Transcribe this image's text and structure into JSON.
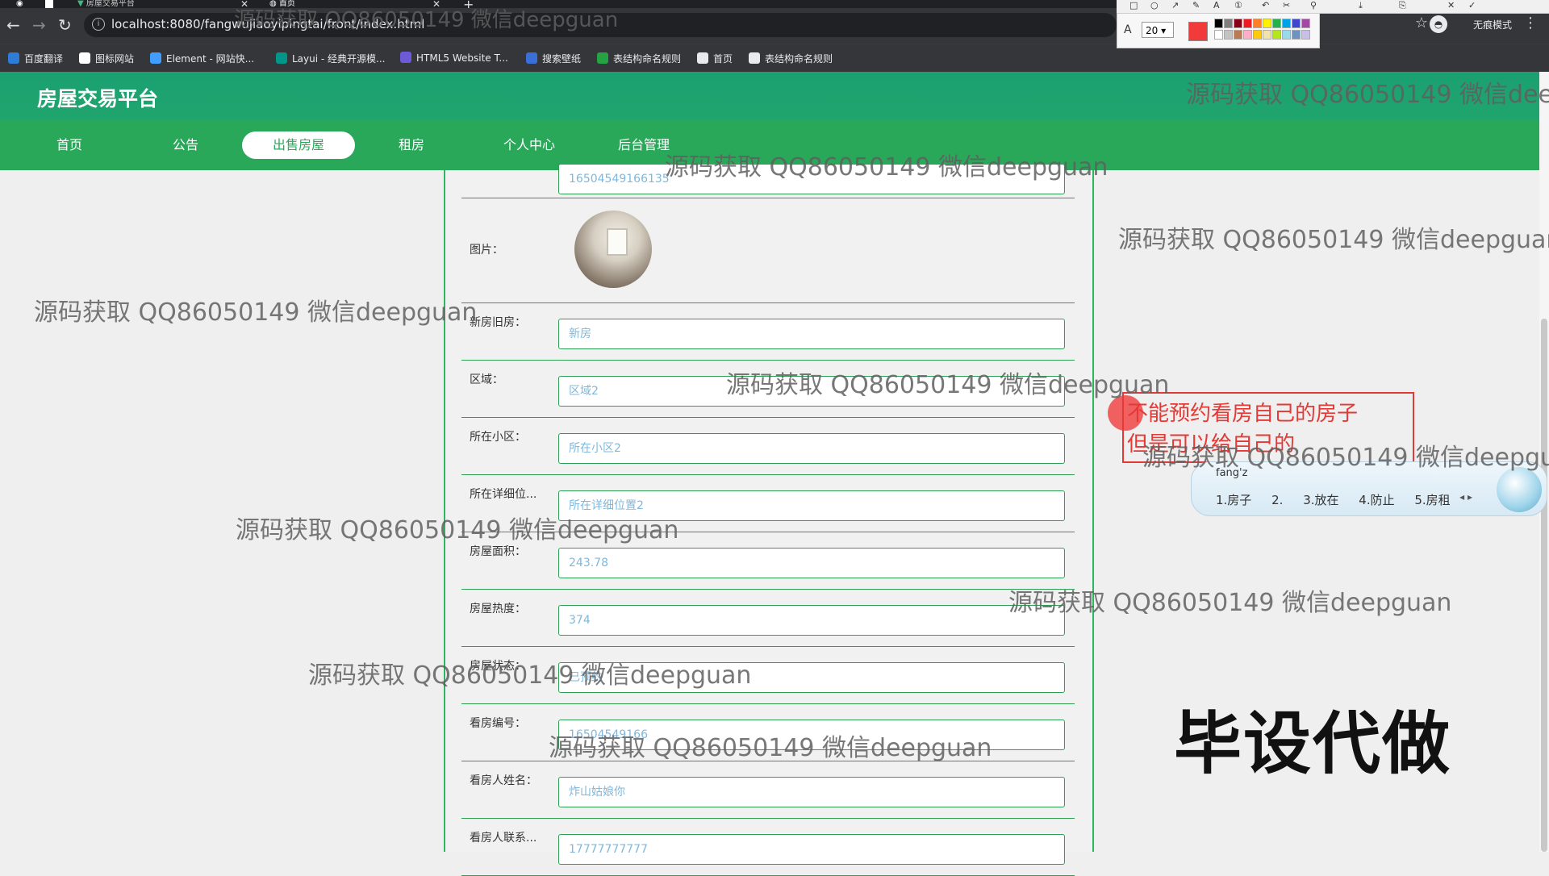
{
  "browser": {
    "tabs": [
      {
        "title": "房屋交易平台"
      },
      {
        "title": "首页"
      }
    ],
    "url": "localhost:8080/fangwujiaoyipingtai/front/index.html",
    "incognito_label": "无痕模式",
    "bookmarks": [
      {
        "label": "百度翻译",
        "color": "#2f7bd8"
      },
      {
        "label": "图标网站",
        "color": "#ffffff"
      },
      {
        "label": "Element - 网站快...",
        "color": "#409eff"
      },
      {
        "label": "Layui - 经典开源模...",
        "color": "#009688"
      },
      {
        "label": "HTML5 Website T...",
        "color": "#6b5bd6"
      },
      {
        "label": "搜索壁纸",
        "color": "#3b6fd8"
      },
      {
        "label": "表结构命名规则",
        "color": "#25a244"
      },
      {
        "label": "首页",
        "color": "#e8eaed"
      },
      {
        "label": "表结构命名规则",
        "color": "#e8eaed"
      }
    ]
  },
  "annotation_tool": {
    "font_size": "20",
    "current_color": "#f23a3a",
    "swatches": [
      "#000000",
      "#7f7f7f",
      "#880015",
      "#ed1c24",
      "#ff7f27",
      "#fff200",
      "#22b14c",
      "#00a2e8",
      "#3f48cc",
      "#a349a4",
      "#ffffff",
      "#c3c3c3",
      "#b97a57",
      "#ffaec9",
      "#ffc90e",
      "#efe4b0",
      "#b5e61d",
      "#99d9ea",
      "#7092be",
      "#c8bfe7"
    ]
  },
  "site": {
    "title": "房屋交易平台",
    "nav": [
      {
        "label": "首页",
        "active": false
      },
      {
        "label": "公告",
        "active": false
      },
      {
        "label": "出售房屋",
        "active": true
      },
      {
        "label": "租房",
        "active": false
      },
      {
        "label": "个人中心",
        "active": false
      },
      {
        "label": "后台管理",
        "active": false
      }
    ]
  },
  "form": {
    "top_input_value": "16504549166135",
    "photo_label": "图片：",
    "fields": [
      {
        "label": "新房旧房：",
        "value": "新房"
      },
      {
        "label": "区域：",
        "value": "区域2"
      },
      {
        "label": "所在小区：",
        "value": "所在小区2"
      },
      {
        "label": "所在详细位...",
        "value": "所在详细位置2"
      },
      {
        "label": "房屋面积：",
        "value": "243.78"
      },
      {
        "label": "房屋热度：",
        "value": "374"
      },
      {
        "label": "房屋状态：",
        "value": "已预约"
      },
      {
        "label": "看房编号：",
        "value": "16504549166"
      },
      {
        "label": "看房人姓名：",
        "value": "炸山姑娘你"
      },
      {
        "label": "看房人联系...",
        "value": "17777777777"
      }
    ]
  },
  "annotation": {
    "line1": "不能预约看房自己的房子",
    "line2": "但是可以给自己的"
  },
  "ime": {
    "pinyin": "fang'z",
    "candidates": [
      "1.房子",
      "2.",
      "3.放在",
      "4.防止",
      "5.房租"
    ]
  },
  "watermarks": {
    "text": "源码获取 QQ86050149 微信deepguan",
    "tag": "毕设代做"
  }
}
